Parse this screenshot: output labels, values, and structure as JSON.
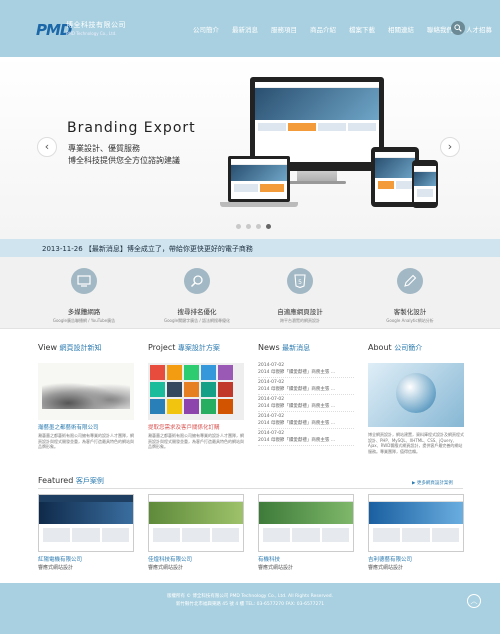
{
  "header": {
    "logo_mark": "PMD",
    "company_cn": "博全科技有限公司",
    "company_en": "PMD Technology Co., Ltd.",
    "nav": [
      "公司簡介",
      "最新消息",
      "服務項目",
      "商品介紹",
      "檔案下載",
      "相關連結",
      "聯絡我們",
      "人才招募"
    ]
  },
  "hero": {
    "title": "Branding Export",
    "sub1": "專業設計、優質服務",
    "sub2": "博全科技提供您全方位諮詢建議",
    "prev": "‹",
    "next": "›"
  },
  "news_bar": "2013-11-26 【最新消息】博全成立了，帶給你更快更好的電子商務",
  "services": [
    {
      "title": "多媒體網路",
      "desc": "Google廣告聯播網 / YouTube廣告",
      "icon": "monitor-icon"
    },
    {
      "title": "搜尋排名優化",
      "desc": "Google關鍵字廣告 / 語法網搜尋優化",
      "icon": "search-icon"
    },
    {
      "title": "自適應網頁設計",
      "desc": "跨平台瀏覽的網頁設計",
      "icon": "html5-icon"
    },
    {
      "title": "客製化設計",
      "desc": "Google Analytic網站分析",
      "icon": "pencil-icon"
    }
  ],
  "columns": {
    "view": {
      "h_en": "View",
      "h_cn": "網頁設計新知",
      "caption": "瀚藝墨之都藝術有限公司",
      "text": "瀚藝墨之都藝術有限公司擁有專業的設計人才團隊，網頁設計與程式開發並重，為客戶打造最具特色的網站與品牌形象。"
    },
    "project": {
      "h_en": "Project",
      "h_cn": "專案設計方案",
      "caption": "提取您需求及客戶關係化訂購",
      "text": "瀚藝墨之都藝術有限公司擁有專業的設計人才團隊，網頁設計與程式開發並重，為客戶打造最具特色的網站與品牌形象。"
    },
    "news": {
      "h_en": "News",
      "h_cn": "最新消息",
      "items": [
        {
          "date": "2014-07-02",
          "text": "2014 母親節「饋愛獻禮」商務主張 ..."
        },
        {
          "date": "2014-07-02",
          "text": "2014 母親節「饋愛獻禮」商務主張 ..."
        },
        {
          "date": "2014-07-02",
          "text": "2014 母親節「饋愛獻禮」商務主張 ..."
        },
        {
          "date": "2014-07-02",
          "text": "2014 母親節「饋愛獻禮」商務主張 ..."
        },
        {
          "date": "2014-07-02",
          "text": "2014 母親節「饋愛獻禮」商務主張 ..."
        }
      ]
    },
    "about": {
      "h_en": "About",
      "h_cn": "公司簡介",
      "text": "博全網頁設計，網站建置，資料庫程式設計及網頁程式設計、PHP、MySQL、XHTML、CSS、jQuery、Ajax、RWD響應式網頁設計，提供客戶最完善的網站服務。專業團隊，值得信賴。"
    }
  },
  "featured": {
    "h_en": "Featured",
    "h_cn": "客戶案例",
    "more": "▶ 更多網頁設計案例",
    "cases": [
      {
        "name": "紅陽電機有限公司",
        "type": "響應式網站設計"
      },
      {
        "name": "佳煌科技有限公司",
        "type": "響應式網站設計"
      },
      {
        "name": "有機科技",
        "type": "響應式網站設計"
      },
      {
        "name": "吉利德藝有限公司",
        "type": "響應式網站設計"
      }
    ]
  },
  "footer": {
    "line1": "版權所有 © 博全科技有限公司 PMD Technology Co., Ltd. All Rights Reserved.",
    "line2": "新竹縣竹北市福興東路 45 號 4 樓  TEL: 03-6577270  FAX: 03-6577271",
    "top": "︿"
  },
  "colors": {
    "header_bg": "#a9d0e0",
    "accent": "#2a7ab0",
    "logo": "#1b67a7"
  }
}
